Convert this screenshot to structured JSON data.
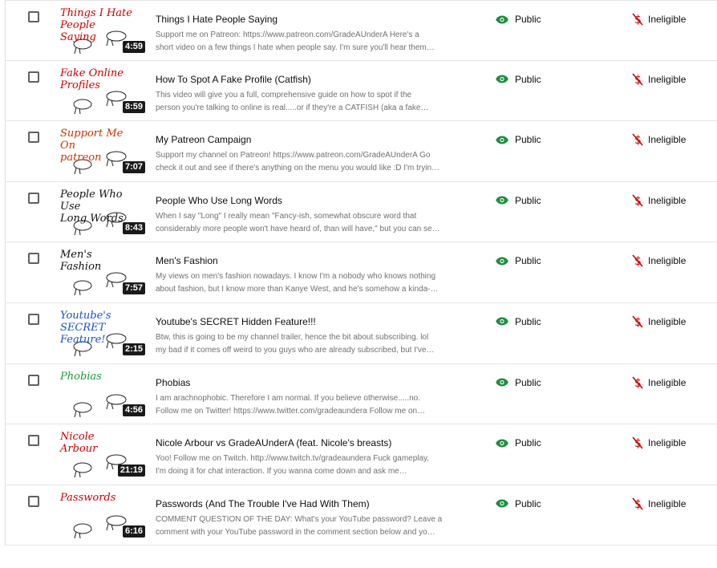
{
  "icons": {
    "visibility": "eye-icon",
    "monetization": "monetization-off-icon"
  },
  "colors": {
    "public_eye": "#1e8e3e",
    "ineligible": "#cc0000",
    "duration_bg": "#1a1a1a"
  },
  "videos": [
    {
      "thumb_text": "Things I Hate\nPeople Saying",
      "thumb_color": "#cc0000",
      "duration": "4:59",
      "title": "Things I Hate People Saying",
      "desc1": "Support me on Patreon: https://www.patreon.com/GradeAUnderA Here's a",
      "desc2": "short video on a few things I hate when people say. I'm sure you'll hear them…",
      "visibility": "Public",
      "monetization": "Ineligible"
    },
    {
      "thumb_text": "Fake Online\nProfiles",
      "thumb_color": "#cc0000",
      "duration": "8:59",
      "title": "How To Spot A Fake Profile (Catfish)",
      "desc1": "This video will give you a full, comprehensive guide on how to spot if the",
      "desc2": "person you're talking to online is real.....or if they're a CATFISH (aka a fake…",
      "visibility": "Public",
      "monetization": "Ineligible"
    },
    {
      "thumb_text": "Support Me On\npatreon",
      "thumb_color": "#cc3300",
      "duration": "7:07",
      "title": "My Patreon Campaign",
      "desc1": "Support my channel on Patreon! https://www.patreon.com/GradeAUnderA Go",
      "desc2": "check it out and see if there's anything on the menu you would like :D I'm tryin…",
      "visibility": "Public",
      "monetization": "Ineligible"
    },
    {
      "thumb_text": "People Who Use\nLong Words",
      "thumb_color": "#111111",
      "duration": "8:43",
      "title": "People Who Use Long Words",
      "desc1": "When I say \"Long\" I really mean \"Fancy-ish, somewhat obscure word that",
      "desc2": "considerably more people won't have heard of, than will have,\" but you can se…",
      "visibility": "Public",
      "monetization": "Ineligible"
    },
    {
      "thumb_text": "Men's\n    Fashion",
      "thumb_color": "#111111",
      "duration": "7:57",
      "title": "Men's Fashion",
      "desc1": "My views on men's fashion nowadays. I know I'm a nobody who knows nothing",
      "desc2": "about fashion, but I know more than Kanye West, and he's somehow a kinda-…",
      "visibility": "Public",
      "monetization": "Ineligible"
    },
    {
      "thumb_text": "Youtube's\nSECRET\nFeature!",
      "thumb_color": "#1a4fcc",
      "duration": "2:15",
      "title": "Youtube's SECRET Hidden Feature!!!",
      "desc1": "Btw, this is going to be my channel trailer, hence the bit about subscribing. lol",
      "desc2": "my bad if it comes off weird to you guys who are already subscribed, but I've…",
      "visibility": "Public",
      "monetization": "Ineligible"
    },
    {
      "thumb_text": "Phobias",
      "thumb_color": "#1a9a3a",
      "duration": "4:56",
      "title": "Phobias",
      "desc1": "I am arachnophobic. Therefore I am normal. If you believe otherwise.....no.",
      "desc2": "Follow me on Twitter! https://www.twitter.com/gradeaundera Follow me on…",
      "visibility": "Public",
      "monetization": "Ineligible"
    },
    {
      "thumb_text": "Nicole\n   Arbour",
      "thumb_color": "#cc0000",
      "duration": "21:19",
      "title": "Nicole Arbour vs GradeAUnderA (feat. Nicole's breasts)",
      "desc1": "Yoo! Follow me on Twitch. http://www.twitch.tv/gradeaundera Fuck gameplay,",
      "desc2": "I'm doing it for chat interaction. If you wanna come down and ask me…",
      "visibility": "Public",
      "monetization": "Ineligible"
    },
    {
      "thumb_text": "Passwords",
      "thumb_color": "#cc0000",
      "duration": "6:16",
      "title": "Passwords (And The Trouble I've Had With Them)",
      "desc1": "COMMENT QUESTION OF THE DAY: What's your YouTube password? Leave a",
      "desc2": "comment with your YouTube password in the comment section below and yo…",
      "visibility": "Public",
      "monetization": "Ineligible"
    }
  ]
}
